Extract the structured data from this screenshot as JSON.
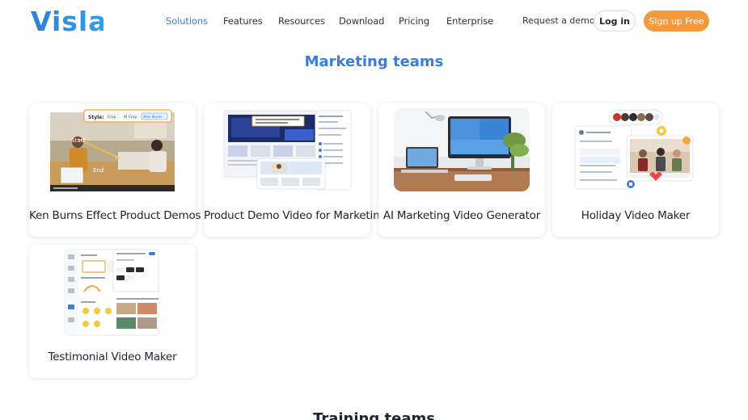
{
  "header": {
    "logo_text": "Visla",
    "nav": [
      {
        "label": "Solutions",
        "active": true
      },
      {
        "label": "Features",
        "active": false
      },
      {
        "label": "Resources",
        "active": false
      },
      {
        "label": "Download",
        "active": false
      },
      {
        "label": "Pricing",
        "active": false
      },
      {
        "label": "Enterprise",
        "active": false
      }
    ],
    "request_demo": "Request a demo",
    "login": "Log in",
    "signup": "Sign up Free"
  },
  "sections": [
    {
      "title": "Marketing teams",
      "cards": [
        {
          "label": "Ken Burns Effect Product Demos",
          "thumb": {
            "style": "Style:",
            "opts": [
              "Crop",
              "AI Crop",
              "Ken Burns"
            ],
            "start": "Start",
            "end": "End"
          }
        },
        {
          "label": "Product Demo Video for Marketing"
        },
        {
          "label": "AI Marketing Video Generator"
        },
        {
          "label": "Holiday Video Maker"
        },
        {
          "label": "Testimonial Video Maker"
        }
      ]
    },
    {
      "title": "Training teams"
    }
  ],
  "colors": {
    "accent": "#3b7dd8",
    "signup": "#f59a3c"
  }
}
